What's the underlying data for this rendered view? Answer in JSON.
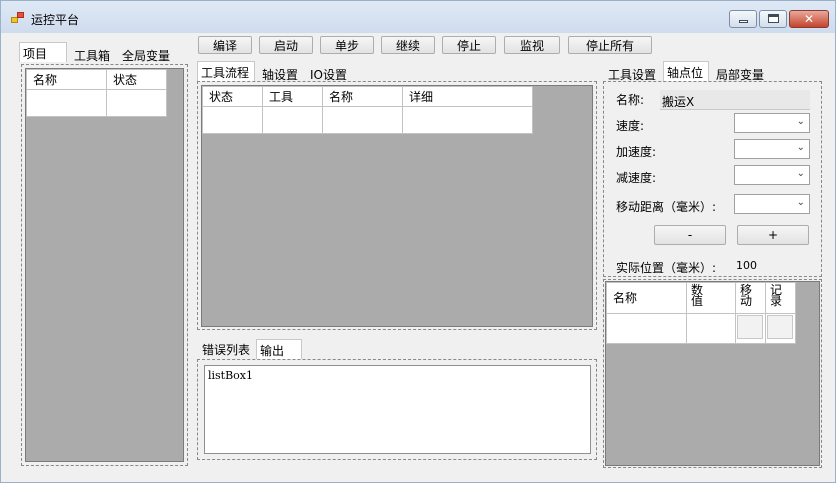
{
  "window": {
    "title": "运控平台"
  },
  "left_tabs": [
    "项目",
    "工具箱",
    "全局变量"
  ],
  "project_table": {
    "columns": [
      "名称",
      "状态"
    ]
  },
  "toolbar": {
    "compile": "编译",
    "start": "启动",
    "step": "单步",
    "continue": "继续",
    "stop": "停止",
    "monitor": "监视",
    "stop_all": "停止所有"
  },
  "center_tabs": [
    "工具流程",
    "轴设置",
    "IO设置"
  ],
  "flow_table": {
    "columns": [
      "状态",
      "工具",
      "名称",
      "详细"
    ]
  },
  "bottom_tabs": [
    "错误列表",
    "输出"
  ],
  "listbox": {
    "text": "listBox1"
  },
  "right_tabs": [
    "工具设置",
    "轴点位",
    "局部变量"
  ],
  "axis_point": {
    "name_label": "名称:",
    "name_value": "搬运X",
    "speed_label": "速度:",
    "accel_label": "加速度:",
    "decel_label": "减速度:",
    "distance_label": "移动距离（毫米）:",
    "minus_label": "-",
    "plus_label": "+",
    "actual_pos_label": "实际位置（毫米）:",
    "actual_pos_value": "100"
  },
  "points_table": {
    "columns": [
      "名称",
      "数值",
      "移动",
      "记录"
    ]
  }
}
